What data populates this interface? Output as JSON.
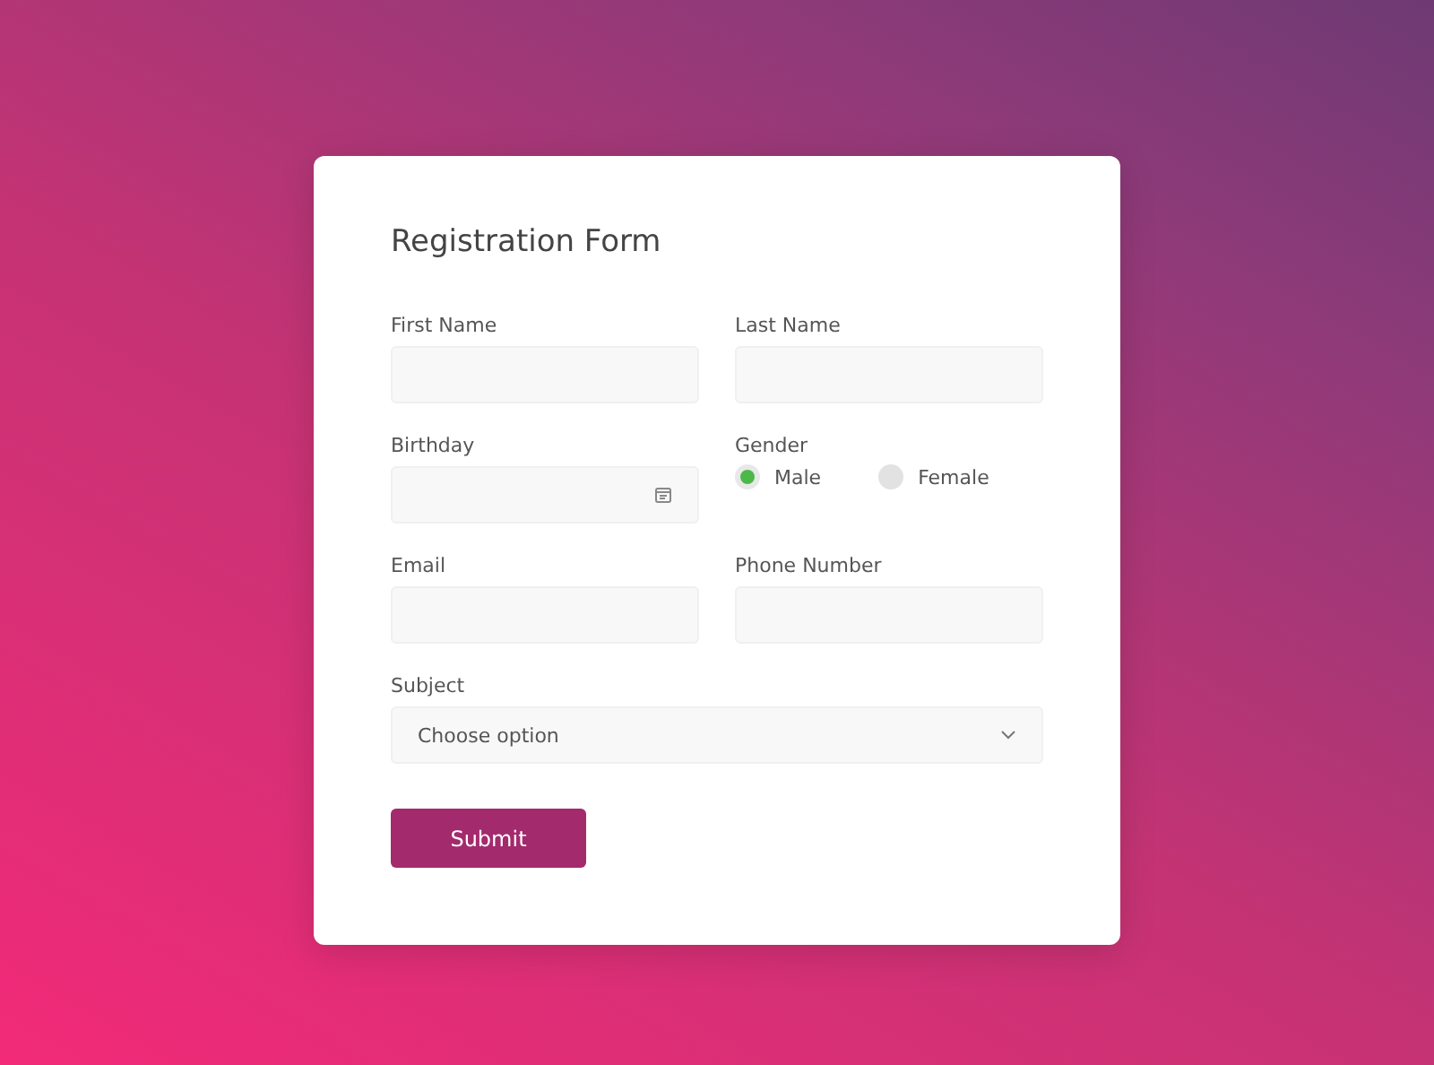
{
  "form": {
    "title": "Registration Form",
    "fields": [
      {
        "kind": "text",
        "label": "First Name"
      },
      {
        "kind": "text",
        "label": "Last Name"
      },
      {
        "kind": "date",
        "label": "Birthday"
      },
      {
        "kind": "radio",
        "label": "Gender",
        "options": [
          {
            "label": "Male",
            "selected": true
          },
          {
            "label": "Female",
            "selected": false
          }
        ]
      },
      {
        "kind": "text",
        "label": "Email"
      },
      {
        "kind": "text",
        "label": "Phone Number"
      },
      {
        "kind": "select",
        "label": "Subject",
        "value": "Choose option"
      }
    ],
    "submit": "Submit"
  }
}
